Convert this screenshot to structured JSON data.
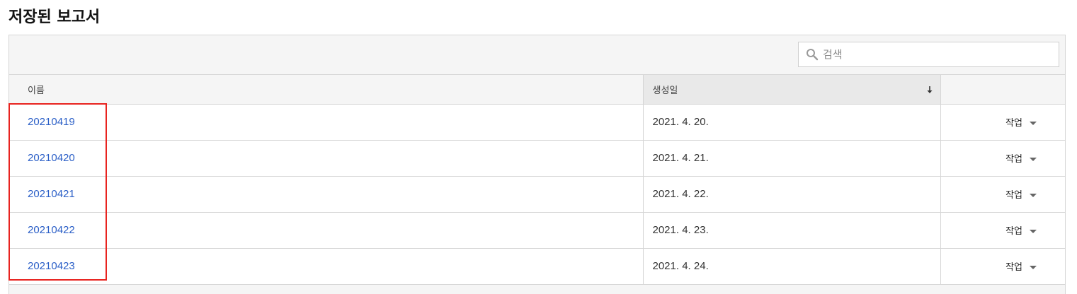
{
  "page": {
    "title": "저장된 보고서"
  },
  "search": {
    "placeholder": "검색",
    "value": ""
  },
  "table": {
    "columns": {
      "name": "이름",
      "created": "생성일",
      "actions": ""
    },
    "sort": {
      "column": "created",
      "direction": "descending"
    },
    "rows": [
      {
        "name": "20210419",
        "created": "2021. 4. 20.",
        "action": "작업"
      },
      {
        "name": "20210420",
        "created": "2021. 4. 21.",
        "action": "작업"
      },
      {
        "name": "20210421",
        "created": "2021. 4. 22.",
        "action": "작업"
      },
      {
        "name": "20210422",
        "created": "2021. 4. 23.",
        "action": "작업"
      },
      {
        "name": "20210423",
        "created": "2021. 4. 24.",
        "action": "작업"
      }
    ]
  },
  "colors": {
    "link": "#2b5fc7",
    "highlight": "#e8231f",
    "panel_bg": "#f5f5f5",
    "border": "#d6d6d6"
  },
  "icons": {
    "search": "search-icon",
    "sort": "sort-arrow-down-icon",
    "dropdown": "chevron-down-icon"
  }
}
